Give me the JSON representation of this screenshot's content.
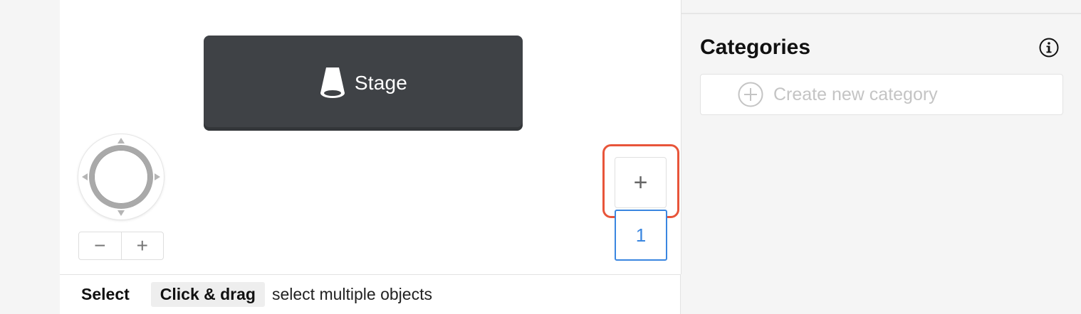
{
  "canvas": {
    "stage": {
      "label": "Stage"
    },
    "zoom": {
      "out_label": "−",
      "in_label": "+"
    },
    "levels": {
      "add_label": "+",
      "current_label": "1"
    }
  },
  "status_bar": {
    "mode": "Select",
    "key": "Click & drag",
    "description": "select multiple objects"
  },
  "categories": {
    "title": "Categories",
    "create_label": "Create new category"
  },
  "colors": {
    "stage_bg": "#3f4246",
    "highlight": "#e8553a",
    "level_accent": "#3a86e0"
  },
  "icons": {
    "stage": "stage-cone-icon",
    "info": "info-icon",
    "create": "plus-circle-icon"
  }
}
